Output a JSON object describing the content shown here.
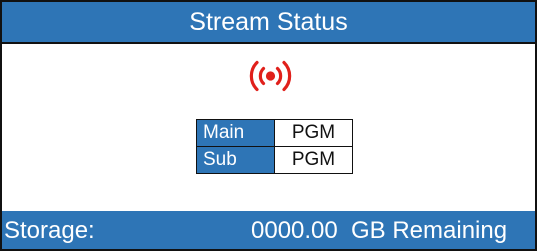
{
  "header": {
    "title": "Stream Status"
  },
  "status_icon": {
    "name": "broadcast-icon",
    "color": "#e0201b"
  },
  "streams": [
    {
      "label": "Main",
      "value": "PGM"
    },
    {
      "label": "Sub",
      "value": "PGM"
    }
  ],
  "footer": {
    "storage_label": "Storage:",
    "storage_value": "0000.00",
    "storage_unit": "GB Remaining"
  },
  "colors": {
    "accent": "#2e75b6",
    "text_on_accent": "#ffffff",
    "border": "#111111"
  }
}
